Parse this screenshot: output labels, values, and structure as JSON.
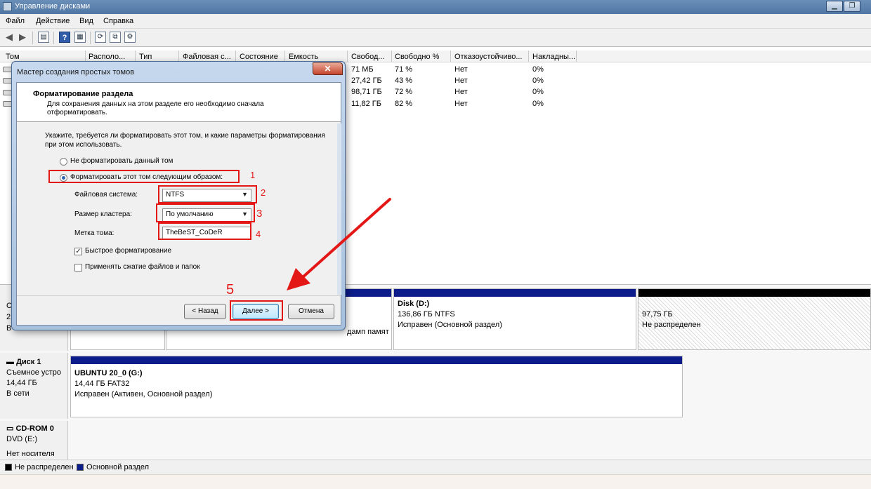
{
  "window": {
    "title": "Управление дисками",
    "minimize_icon": "minimize-icon",
    "restore_icon": "restore-icon"
  },
  "menu": [
    "Файл",
    "Действие",
    "Вид",
    "Справка"
  ],
  "toolbar": {
    "icons": [
      "back-arrow-icon",
      "forward-arrow-icon",
      "console-tree-icon",
      "help-icon",
      "properties-icon",
      "refresh-icon",
      "export-list-icon",
      "disk-settings-icon"
    ],
    "help_glyph": "?"
  },
  "columns": [
    "Том",
    "Располо...",
    "Тип",
    "Файловая с...",
    "Состояние",
    "Емкость",
    "Свобод...",
    "Свободно %",
    "Отказоустойчиво...",
    "Накладны..."
  ],
  "volumes": [
    {
      "free": "71 МБ",
      "free_pct": "71 %",
      "fault_tolerance": "Нет",
      "overhead": "0%"
    },
    {
      "free": "27,42 ГБ",
      "free_pct": "43 %",
      "fault_tolerance": "Нет",
      "overhead": "0%"
    },
    {
      "free": "98,71 ГБ",
      "free_pct": "72 %",
      "fault_tolerance": "Нет",
      "overhead": "0%"
    },
    {
      "free": "11,82 ГБ",
      "free_pct": "82 %",
      "fault_tolerance": "Нет",
      "overhead": "0%"
    }
  ],
  "disk0": {
    "partial_labels": [
      "С",
      "2",
      "В"
    ],
    "dump_text": "дамп памят",
    "disk_d": {
      "name": "Disk  (D:)",
      "size": "136,86 ГБ NTFS",
      "status": "Исправен (Основной раздел)"
    },
    "unallocated": {
      "size": "97,75 ГБ",
      "status": "Не распределен"
    }
  },
  "disk1": {
    "name": "Диск 1",
    "type": "Съемное устро",
    "size": "14,44 ГБ",
    "state": "В сети",
    "partition": {
      "name": "UBUNTU 20_0  (G:)",
      "size": "14,44 ГБ FAT32",
      "status": "Исправен (Активен, Основной раздел)"
    }
  },
  "cdrom": {
    "name": "CD-ROM 0",
    "drive": "DVD (E:)",
    "media": "Нет носителя"
  },
  "legend": {
    "unallocated": "Не распределен",
    "primary": "Основной раздел",
    "unallocated_color": "#000000",
    "primary_color": "#0c1c8a"
  },
  "dialog": {
    "title": "Мастер создания простых томов",
    "close_glyph": "✕",
    "heading": "Форматирование раздела",
    "subheading_line1": "Для сохранения данных на этом разделе его необходимо сначала",
    "subheading_line2": "отформатировать.",
    "prompt_line1": "Укажите, требуется ли форматировать этот том, и какие параметры форматирования",
    "prompt_line2": "при этом использовать.",
    "option_no_format": "Не форматировать данный том",
    "option_format": "Форматировать этот том следующим образом:",
    "fs_label": "Файловая система:",
    "fs_value": "NTFS",
    "cluster_label": "Размер кластера:",
    "cluster_value": "По умолчанию",
    "volume_label_label": "Метка тома:",
    "volume_label_value": "TheBeST_CoDeR",
    "quick_format": "Быстрое форматирование",
    "quick_format_checked": true,
    "compression": "Применять сжатие файлов и папок",
    "compression_checked": false,
    "back_button": "< Назад",
    "next_button": "Далее >",
    "cancel_button": "Отмена"
  },
  "annotations": [
    "1",
    "2",
    "3",
    "4",
    "5"
  ],
  "annotation_color": "#e41717"
}
